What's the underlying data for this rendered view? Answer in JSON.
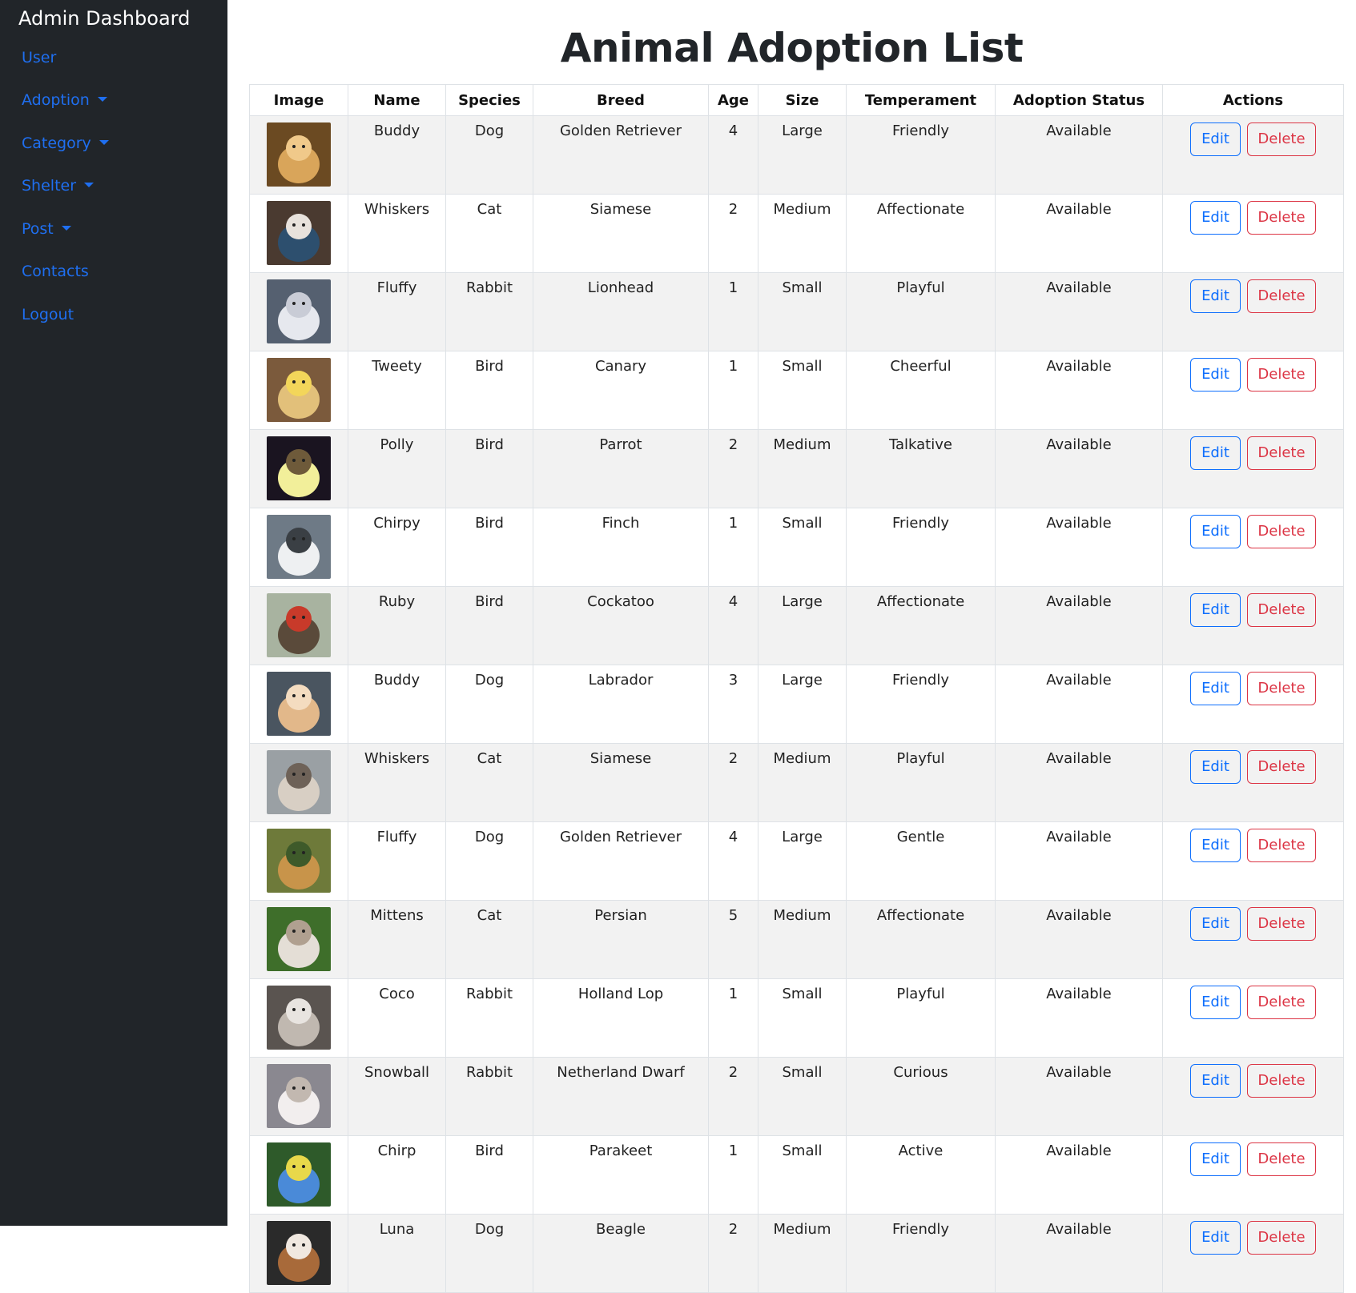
{
  "sidebar": {
    "brand": "Admin Dashboard",
    "items": [
      {
        "label": "User",
        "dropdown": false
      },
      {
        "label": "Adoption",
        "dropdown": true
      },
      {
        "label": "Category",
        "dropdown": true
      },
      {
        "label": "Shelter",
        "dropdown": true
      },
      {
        "label": "Post",
        "dropdown": true
      },
      {
        "label": "Contacts",
        "dropdown": false
      },
      {
        "label": "Logout",
        "dropdown": false
      }
    ]
  },
  "main": {
    "title": "Animal Adoption List",
    "columns": [
      "Image",
      "Name",
      "Species",
      "Breed",
      "Age",
      "Size",
      "Temperament",
      "Adoption Status",
      "Actions"
    ],
    "edit_label": "Edit",
    "delete_label": "Delete",
    "rows": [
      {
        "image": "golden-retriever-puppy-photo",
        "name": "Buddy",
        "species": "Dog",
        "breed": "Golden Retriever",
        "age": "4",
        "size": "Large",
        "temperament": "Friendly",
        "status": "Available"
      },
      {
        "image": "siamese-cat-photo",
        "name": "Whiskers",
        "species": "Cat",
        "breed": "Siamese",
        "age": "2",
        "size": "Medium",
        "temperament": "Affectionate",
        "status": "Available"
      },
      {
        "image": "white-rabbit-photo",
        "name": "Fluffy",
        "species": "Rabbit",
        "breed": "Lionhead",
        "age": "1",
        "size": "Small",
        "temperament": "Playful",
        "status": "Available"
      },
      {
        "image": "canary-chick-photo",
        "name": "Tweety",
        "species": "Bird",
        "breed": "Canary",
        "age": "1",
        "size": "Small",
        "temperament": "Cheerful",
        "status": "Available"
      },
      {
        "image": "parrot-photo",
        "name": "Polly",
        "species": "Bird",
        "breed": "Parrot",
        "age": "2",
        "size": "Medium",
        "temperament": "Talkative",
        "status": "Available"
      },
      {
        "image": "white-finch-photo",
        "name": "Chirpy",
        "species": "Bird",
        "breed": "Finch",
        "age": "1",
        "size": "Small",
        "temperament": "Friendly",
        "status": "Available"
      },
      {
        "image": "red-headed-bird-photo",
        "name": "Ruby",
        "species": "Bird",
        "breed": "Cockatoo",
        "age": "4",
        "size": "Large",
        "temperament": "Affectionate",
        "status": "Available"
      },
      {
        "image": "fluffy-puppy-photo",
        "name": "Buddy",
        "species": "Dog",
        "breed": "Labrador",
        "age": "3",
        "size": "Large",
        "temperament": "Friendly",
        "status": "Available"
      },
      {
        "image": "grey-cat-photo",
        "name": "Whiskers",
        "species": "Cat",
        "breed": "Siamese",
        "age": "2",
        "size": "Medium",
        "temperament": "Playful",
        "status": "Available"
      },
      {
        "image": "running-dog-photo",
        "name": "Fluffy",
        "species": "Dog",
        "breed": "Golden Retriever",
        "age": "4",
        "size": "Large",
        "temperament": "Gentle",
        "status": "Available"
      },
      {
        "image": "persian-cat-photo",
        "name": "Mittens",
        "species": "Cat",
        "breed": "Persian",
        "age": "5",
        "size": "Medium",
        "temperament": "Affectionate",
        "status": "Available"
      },
      {
        "image": "lop-rabbit-photo",
        "name": "Coco",
        "species": "Rabbit",
        "breed": "Holland Lop",
        "age": "1",
        "size": "Small",
        "temperament": "Playful",
        "status": "Available"
      },
      {
        "image": "dwarf-rabbit-photo",
        "name": "Snowball",
        "species": "Rabbit",
        "breed": "Netherland Dwarf",
        "age": "2",
        "size": "Small",
        "temperament": "Curious",
        "status": "Available"
      },
      {
        "image": "blue-parakeet-photo",
        "name": "Chirp",
        "species": "Bird",
        "breed": "Parakeet",
        "age": "1",
        "size": "Small",
        "temperament": "Active",
        "status": "Available"
      },
      {
        "image": "beagle-in-jacket-photo",
        "name": "Luna",
        "species": "Dog",
        "breed": "Beagle",
        "age": "2",
        "size": "Medium",
        "temperament": "Friendly",
        "status": "Available"
      }
    ]
  },
  "colors": {
    "sidebar_bg": "#212529",
    "link": "#1f6ff0",
    "edit": "#0d6efd",
    "delete": "#dc3545",
    "stripe": "#f2f2f2"
  }
}
